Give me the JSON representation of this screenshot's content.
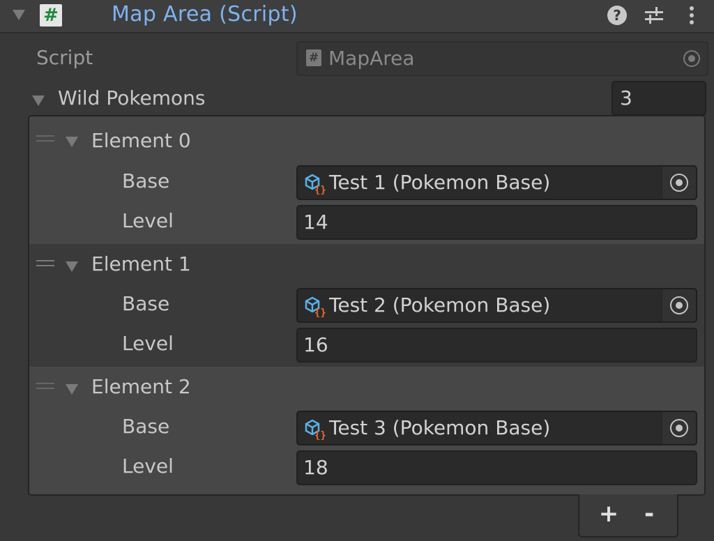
{
  "header": {
    "title": "Map Area (Script)",
    "script_badge": "#",
    "help_label": "?"
  },
  "script_row": {
    "label": "Script",
    "value": "MapArea",
    "badge": "#"
  },
  "list": {
    "label": "Wild Pokemons",
    "size": "3",
    "elements": [
      {
        "title": "Element 0",
        "base_label": "Base",
        "base_value": "Test 1 (Pokemon Base)",
        "level_label": "Level",
        "level_value": "14"
      },
      {
        "title": "Element 1",
        "base_label": "Base",
        "base_value": "Test 2 (Pokemon Base)",
        "level_label": "Level",
        "level_value": "16"
      },
      {
        "title": "Element 2",
        "base_label": "Base",
        "base_value": "Test 3 (Pokemon Base)",
        "level_label": "Level",
        "level_value": "18"
      }
    ]
  },
  "buttons": {
    "add": "+",
    "remove": "-"
  },
  "colors": {
    "title_blue": "#7fb2f0",
    "background": "#383838",
    "field": "#2a2a2a",
    "script_green": "#1f8a3a",
    "asset_icon_blue": "#5ab0e8",
    "asset_icon_orange": "#f06a2a"
  },
  "icons": [
    "foldout-arrow-icon",
    "script-icon",
    "help-icon",
    "presets-sliders-icon",
    "kebab-menu-icon",
    "object-picker-icon",
    "drag-handle-icon",
    "scriptable-object-icon"
  ]
}
